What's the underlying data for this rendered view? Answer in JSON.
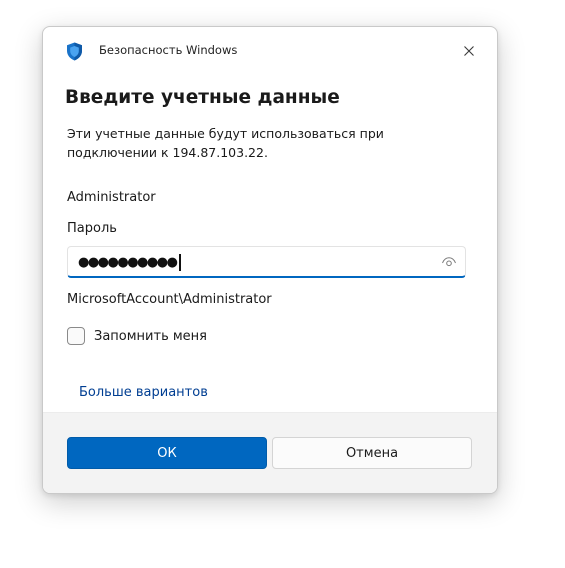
{
  "window": {
    "title": "Безопасность Windows",
    "icon": "shield-icon",
    "close_icon": "close-icon"
  },
  "heading": "Введите учетные данные",
  "description": "Эти учетные данные будут использоваться при подключении к 194.87.103.22.",
  "username": "Administrator",
  "password": {
    "label": "Пароль",
    "masked_value": "●●●●●●●●●●",
    "reveal_icon": "eye-icon"
  },
  "account_name": "MicrosoftAccount\\Administrator",
  "remember_me": {
    "label": "Запомнить меня",
    "checked": false
  },
  "more_options": "Больше вариантов",
  "buttons": {
    "ok": "ОК",
    "cancel": "Отмена"
  },
  "colors": {
    "accent": "#0067c0",
    "link": "#003e92",
    "footer_bg": "#f3f3f3"
  }
}
